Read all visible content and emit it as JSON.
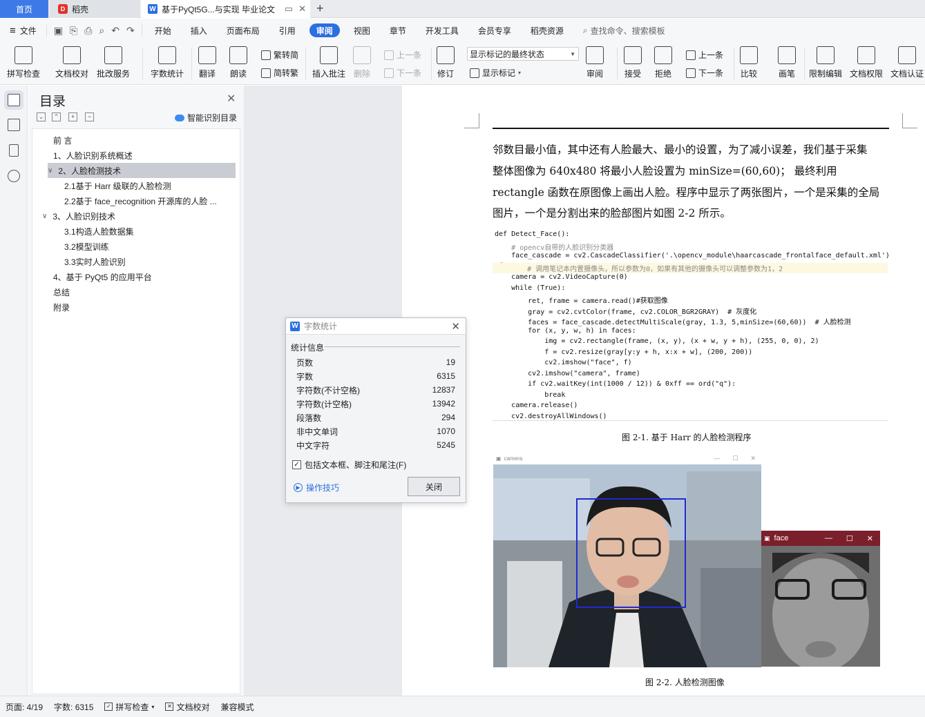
{
  "tabs": {
    "home": "首页",
    "daoke": "稻壳",
    "doc": "基于PyQt5G...与实现 毕业论文",
    "add": "+"
  },
  "menubar": {
    "file": "文件",
    "items": [
      "开始",
      "插入",
      "页面布局",
      "引用",
      "审阅",
      "视图",
      "章节",
      "开发工具",
      "会员专享",
      "稻壳资源"
    ],
    "active": "审阅",
    "search": "查找命令、搜索模板"
  },
  "ribbon": {
    "spellcheck": "拼写检查",
    "doccheck": "文档校对",
    "correction": "批改服务",
    "wordcount": "字数统计",
    "translate": "翻译",
    "read": "朗读",
    "trad_simp": "繁转简",
    "simp_trad": "简转繁",
    "insert_comment": "插入批注",
    "delete": "删除",
    "prev": "上一条",
    "next": "下一条",
    "revise": "修订",
    "display_mode": "显示标记的最终状态",
    "show_marks": "显示标记",
    "review": "审阅",
    "accept": "接受",
    "reject": "拒绝",
    "prev2": "上一条",
    "next2": "下一条",
    "compare": "比较",
    "pen": "画笔",
    "restrict": "限制编辑",
    "permission": "文档权限",
    "certify": "文档认证"
  },
  "toc": {
    "title": "目录",
    "smart": "智能识别目录",
    "items": [
      {
        "label": "前 言",
        "level": 1,
        "chev": ""
      },
      {
        "label": "1、人脸识别系统概述",
        "level": 1,
        "chev": ""
      },
      {
        "label": "2、人脸检测技术",
        "level": 1,
        "chev": "v",
        "selected": true
      },
      {
        "label": "2.1基于 Harr 级联的人脸检测",
        "level": 2,
        "chev": ""
      },
      {
        "label": "2.2基于 face_recognition 开源库的人脸 ...",
        "level": 2,
        "chev": ""
      },
      {
        "label": "3、人脸识别技术",
        "level": 1,
        "chev": "v"
      },
      {
        "label": "3.1构造人脸数据集",
        "level": 2,
        "chev": ""
      },
      {
        "label": "3.2模型训练",
        "level": 2,
        "chev": ""
      },
      {
        "label": "3.3实时人脸识别",
        "level": 2,
        "chev": ""
      },
      {
        "label": "4、基于 PyQt5 的应用平台",
        "level": 1,
        "chev": ""
      },
      {
        "label": "总结",
        "level": 1,
        "chev": ""
      },
      {
        "label": "附录",
        "level": 1,
        "chev": ""
      }
    ]
  },
  "document": {
    "lines": [
      "邻数目最小值，其中还有人脸最大、最小的设置，为了减小误差，我们基于采集",
      "整体图像为  640x480 将最小人脸设置为  minSize=(60,60)；   最终利用",
      "rectangle 函数在原图像上画出人脸。程序中显示了两张图片，一个是采集的全局",
      "图片，一个是分割出来的脸部图片如图  2-2 所示。"
    ],
    "code": [
      "def Detect_Face():",
      "    # opencv自带的人脸识别分类器",
      "    face_cascade = cv2.CascadeClassifier('.\\opencv_module\\haarcascade_frontalface_default.xml')",
      "    # 调用笔记本内置摄像头，所以参数为0，如果有其他的摄像头可以调整参数为1，2",
      "    camera = cv2.VideoCapture(0)",
      "    while (True):",
      "        ret, frame = camera.read()#获取图像",
      "        gray = cv2.cvtColor(frame, cv2.COLOR_BGR2GRAY)  # 灰度化",
      "        faces = face_cascade.detectMultiScale(gray, 1.3, 5,minSize=(60,60))  # 人脸检测",
      "        for (x, y, w, h) in faces:",
      "            img = cv2.rectangle(frame, (x, y), (x + w, y + h), (255, 0, 0), 2)",
      "            f = cv2.resize(gray[y:y + h, x:x + w], (200, 200))",
      "            cv2.imshow(\"face\", f)",
      "        cv2.imshow(\"camera\", frame)",
      "        if cv2.waitKey(int(1000 / 12)) & 0xff == ord(\"q\"):",
      "            break",
      "    camera.release()",
      "    cv2.destroyAllWindows()"
    ],
    "caption1": "图 2-1. 基于 Harr 的人脸检测程序",
    "caption2": "图 2-2.  人脸检测图像",
    "cam_title": "camera",
    "face_title": "face"
  },
  "wordcount": {
    "title": "字数统计",
    "section": "统计信息",
    "rows": [
      {
        "label": "页数",
        "value": "19"
      },
      {
        "label": "字数",
        "value": "6315"
      },
      {
        "label": "字符数(不计空格)",
        "value": "12837"
      },
      {
        "label": "字符数(计空格)",
        "value": "13942"
      },
      {
        "label": "段落数",
        "value": "294"
      },
      {
        "label": "非中文单词",
        "value": "1070"
      },
      {
        "label": "中文字符",
        "value": "5245"
      }
    ],
    "include": "包括文本框、脚注和尾注(F)",
    "tips": "操作技巧",
    "close": "关闭"
  },
  "status": {
    "page": "页面: 4/19",
    "words": "字数: 6315",
    "spell": "拼写检查",
    "doccheck": "文档校对",
    "compat": "兼容模式"
  }
}
